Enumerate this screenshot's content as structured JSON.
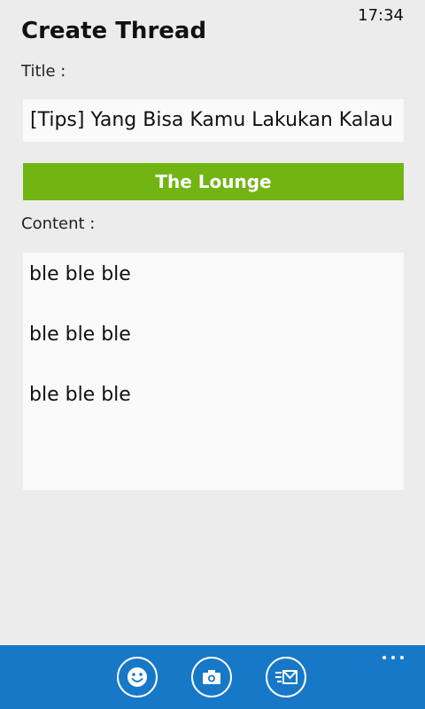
{
  "status_bar": {
    "time": "17:34"
  },
  "page": {
    "title": "Create Thread"
  },
  "form": {
    "title_label": "Title :",
    "title_value": "[Tips] Yang Bisa Kamu Lakukan Kalau",
    "forum_label": "The Lounge",
    "content_label": "Content :",
    "content_lines": [
      "ble ble ble",
      "ble ble ble",
      "ble ble ble"
    ]
  },
  "app_bar": {
    "buttons": [
      {
        "icon": "emoji-icon"
      },
      {
        "icon": "camera-icon"
      },
      {
        "icon": "send-message-icon"
      }
    ],
    "more_icon": "more-dots-icon"
  },
  "colors": {
    "background": "#ececec",
    "accent_green": "#72b412",
    "app_bar_blue": "#1878c8",
    "field_background": "#fafafa"
  }
}
